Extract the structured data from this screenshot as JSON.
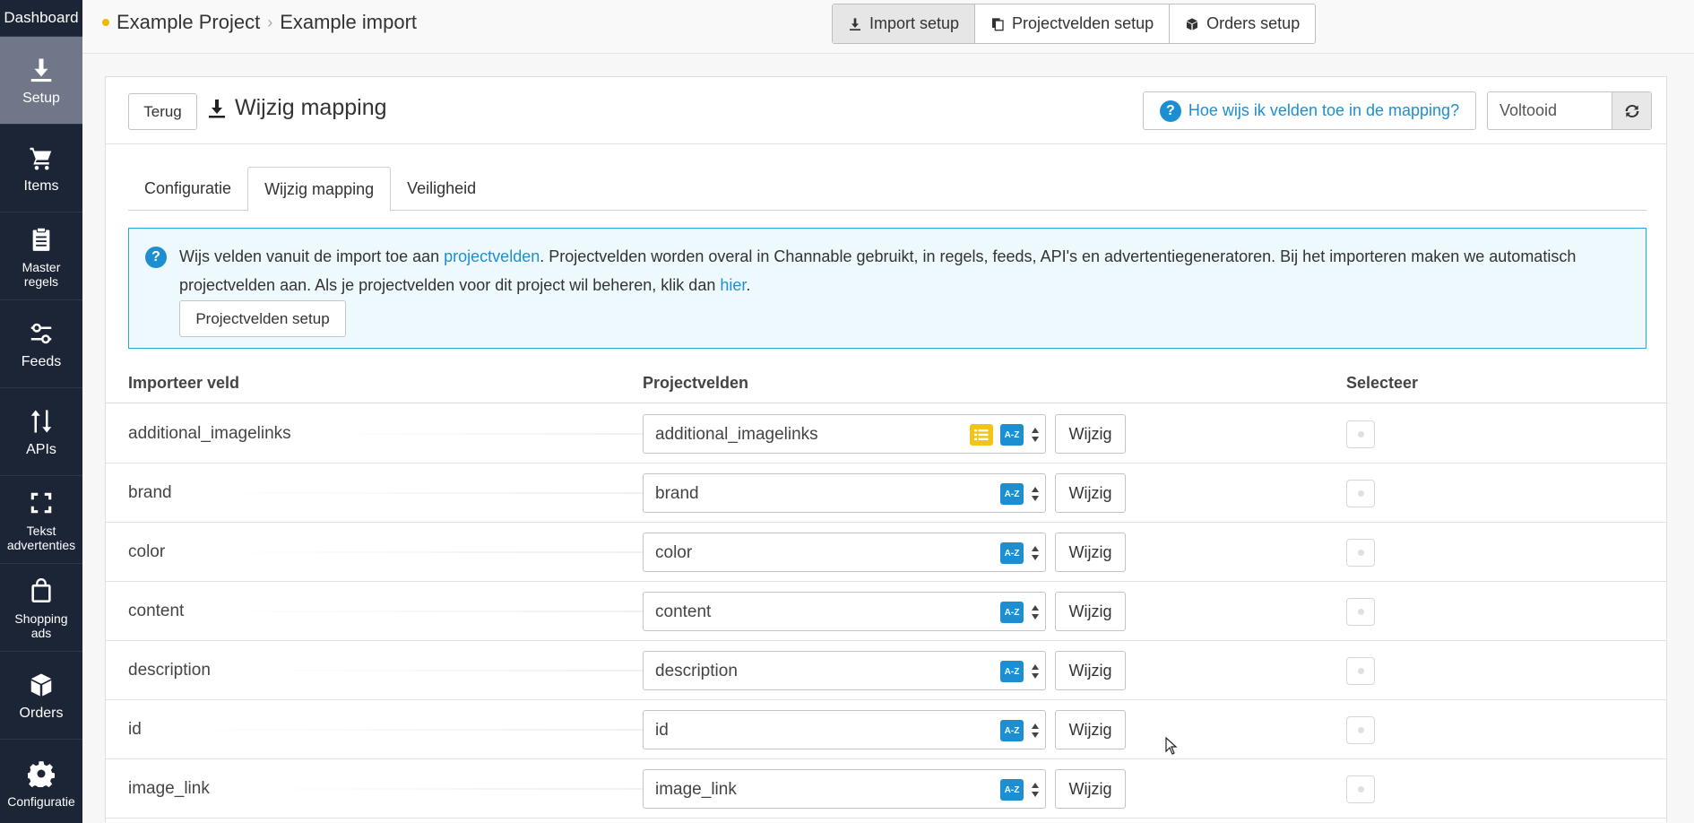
{
  "sidebar": {
    "dashboard": "Dashboard",
    "items": [
      {
        "label": "Setup",
        "icon": "download-icon"
      },
      {
        "label": "Items",
        "icon": "cart-icon"
      },
      {
        "label": "Master regels",
        "icon": "clipboard-icon"
      },
      {
        "label": "Feeds",
        "icon": "sliders-icon"
      },
      {
        "label": "APIs",
        "icon": "arrows-updown-icon"
      },
      {
        "label": "Tekst advertenties",
        "icon": "expand-icon"
      },
      {
        "label": "Shopping ads",
        "icon": "shopping-bag-icon"
      },
      {
        "label": "Orders",
        "icon": "box-icon"
      },
      {
        "label": "Configuratie",
        "icon": "gear-icon"
      }
    ],
    "active": "Setup"
  },
  "breadcrumb": {
    "project": "Example Project",
    "page": "Example import"
  },
  "topnav": {
    "import_setup": "Import setup",
    "projectvelden_setup": "Projectvelden setup",
    "orders_setup": "Orders setup"
  },
  "header": {
    "back": "Terug",
    "title": "Wijzig mapping",
    "help": "Hoe wijs ik velden toe in de mapping?",
    "status": "Voltooid"
  },
  "tabs": [
    "Configuratie",
    "Wijzig mapping",
    "Veiligheid"
  ],
  "info": {
    "t1": "Wijs velden vanuit de import toe aan ",
    "link1": "projectvelden",
    "t2": ". Projectvelden worden overal in Channable gebruikt, in regels, feeds, API's en advertentiegeneratoren. Bij het importeren maken we automatisch projectvelden aan. Als je projectvelden voor dit project wil beheren, klik dan ",
    "link2": "hier",
    "t3": ".",
    "button": "Projectvelden setup"
  },
  "table": {
    "col_import": "Importeer veld",
    "col_project": "Projectvelden",
    "col_select": "Selecteer",
    "edit_label": "Wijzig",
    "az_label": "A-Z",
    "rows": [
      {
        "import": "additional_imagelinks",
        "project": "additional_imagelinks",
        "list_icon": true
      },
      {
        "import": "brand",
        "project": "brand",
        "list_icon": false
      },
      {
        "import": "color",
        "project": "color",
        "list_icon": false
      },
      {
        "import": "content",
        "project": "content",
        "list_icon": false
      },
      {
        "import": "description",
        "project": "description",
        "list_icon": false
      },
      {
        "import": "id",
        "project": "id",
        "list_icon": false
      },
      {
        "import": "image_link",
        "project": "image_link",
        "list_icon": false
      }
    ]
  },
  "colors": {
    "sidebar": "#1c2536",
    "accent": "#1d8fd1",
    "list_badge": "#f0c419"
  }
}
